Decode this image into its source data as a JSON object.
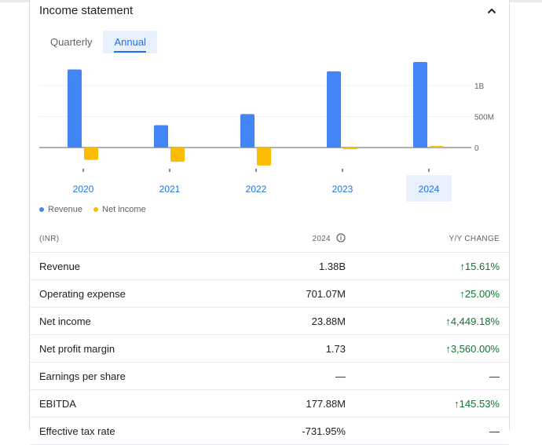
{
  "section": {
    "title": "Income statement",
    "tabs": [
      {
        "label": "Quarterly",
        "active": false
      },
      {
        "label": "Annual",
        "active": true
      }
    ]
  },
  "chart_data": {
    "type": "bar",
    "categories": [
      "2020",
      "2021",
      "2022",
      "2023",
      "2024"
    ],
    "selected_category": "2024",
    "series": [
      {
        "name": "Revenue",
        "color": "#4285f4",
        "values": [
          1260000000,
          360000000,
          540000000,
          1230000000,
          1380000000
        ]
      },
      {
        "name": "Net income",
        "color": "#fbbc04",
        "values": [
          -200000000,
          -230000000,
          -290000000,
          -10000000,
          23880000
        ]
      }
    ],
    "y_ticks": [
      {
        "value": 1000000000,
        "label": "1B"
      },
      {
        "value": 500000000,
        "label": "500M"
      },
      {
        "value": 0,
        "label": "0"
      }
    ],
    "ylim": [
      -320000000,
      1500000000
    ],
    "legend_position": "bottom-left"
  },
  "table": {
    "headers": {
      "label": "(INR)",
      "year": "2024",
      "change": "Y/Y CHANGE"
    },
    "rows": [
      {
        "label": "Revenue",
        "value": "1.38B",
        "change": "15.61%",
        "direction": "up"
      },
      {
        "label": "Operating expense",
        "value": "701.07M",
        "change": "25.00%",
        "direction": "up"
      },
      {
        "label": "Net income",
        "value": "23.88M",
        "change": "4,449.18%",
        "direction": "up"
      },
      {
        "label": "Net profit margin",
        "value": "1.73",
        "change": "3,560.00%",
        "direction": "up"
      },
      {
        "label": "Earnings per share",
        "value": "—",
        "change": "—",
        "direction": "none"
      },
      {
        "label": "EBITDA",
        "value": "177.88M",
        "change": "145.53%",
        "direction": "up"
      },
      {
        "label": "Effective tax rate",
        "value": "-731.95%",
        "change": "—",
        "direction": "none"
      }
    ]
  },
  "icons": {
    "collapse": "chevron-up-icon",
    "info": "info-icon",
    "up_arrow": "arrow-up-icon"
  }
}
